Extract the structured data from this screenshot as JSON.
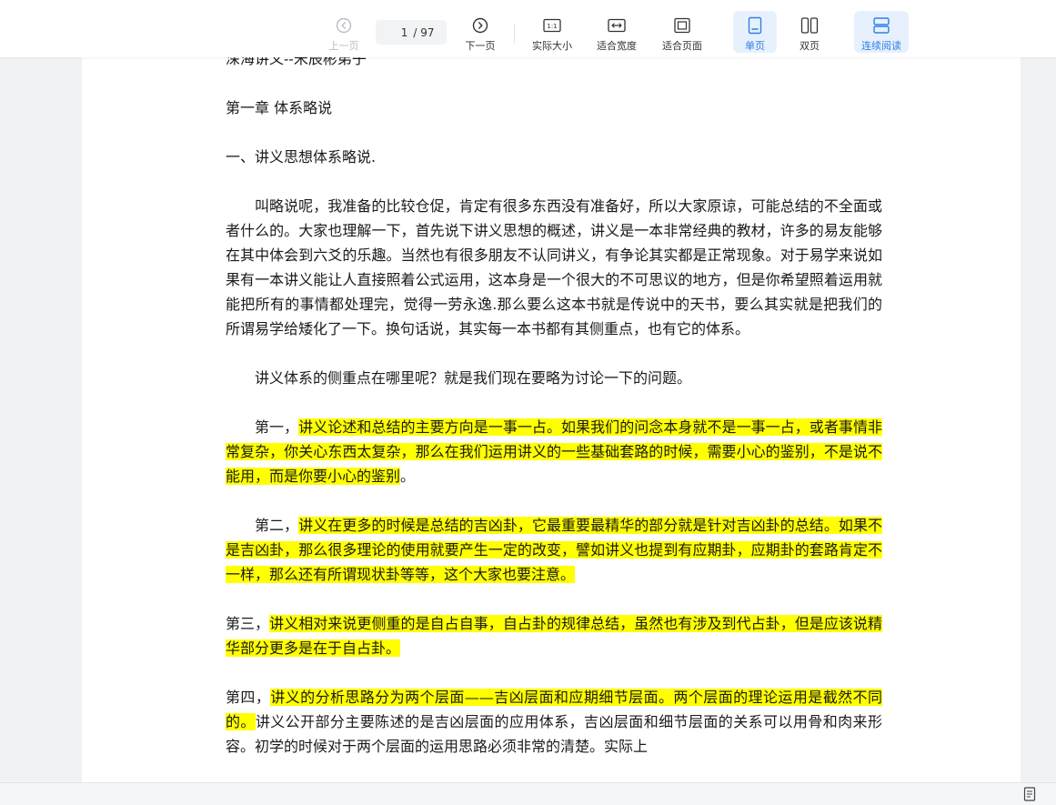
{
  "toolbar": {
    "prev_label": "上一页",
    "current_page": "1",
    "total_pages": "/ 97",
    "next_label": "下一页",
    "actual_size_label": "实际大小",
    "fit_width_label": "适合宽度",
    "fit_page_label": "适合页面",
    "single_page_label": "单页",
    "double_page_label": "双页",
    "continuous_label": "连续阅读",
    "accent_color": "#2f7fe6"
  },
  "document": {
    "partial_top_line": "深海讲义--宋辰彬弟子",
    "chapter_title": "第一章  体系略说",
    "section_title": "一、讲义思想体系略说.",
    "para1": "叫略说呢，我准备的比较仓促，肯定有很多东西没有准备好，所以大家原谅，可能总结的不全面或者什么的。大家也理解一下，首先说下讲义思想的概述，讲义是一本非常经典的教材，许多的易友能够在其中体会到六爻的乐趣。当然也有很多朋友不认同讲义，有争论其实都是正常现象。对于易学来说如果有一本讲义能让人直接照着公式运用，这本身是一个很大的不可思议的地方，但是你希望照着运用就能把所有的事情都处理完，觉得一劳永逸.那么要么这本书就是传说中的天书，要么其实就是把我们的所谓易学给矮化了一下。换句话说，其实每一本书都有其侧重点，也有它的体系。",
    "para2": "讲义体系的侧重点在哪里呢？就是我们现在要略为讨论一下的问题。",
    "point1_lead": "第一，",
    "point1_hl": "讲义论述和总结的主要方向是一事一占。如果我们的问念本身就不是一事一占，或者事情非常复杂，你关心东西太复杂，那么在我们运用讲义的一些基础套路的时候，需要小心的鉴别，不是说不能用，而是你要小心的鉴别",
    "point1_tail": "。",
    "point2_lead": "第二，",
    "point2_hl": "讲义在更多的时候是总结的吉凶卦，它最重要最精华的部分就是针对吉凶卦的总结。如果不是吉凶卦，那么很多理论的使用就要产生一定的改变，譬如讲义也提到有应期卦，应期卦的套路肯定不一样，那么还有所谓现状卦等等，这个大家也要注意。",
    "point3_lead": "第三，",
    "point3_hl": "讲义相对来说更侧重的是自占自事，自占卦的规律总结，虽然也有涉及到代占卦，但是应该说精华部分更多是在于自占卦。",
    "point4_lead": "第四，",
    "point4_hl": "讲义的分析思路分为两个层面——吉凶层面和应期细节层面。两个层面的理论运用是截然不同的。",
    "point4_rest": "讲义公开部分主要陈述的是吉凶层面的应用体系，吉凶层面和细节层面的关系可以用骨和肉来形容。初学的时候对于两个层面的运用思路必须非常的清楚。实际上"
  }
}
